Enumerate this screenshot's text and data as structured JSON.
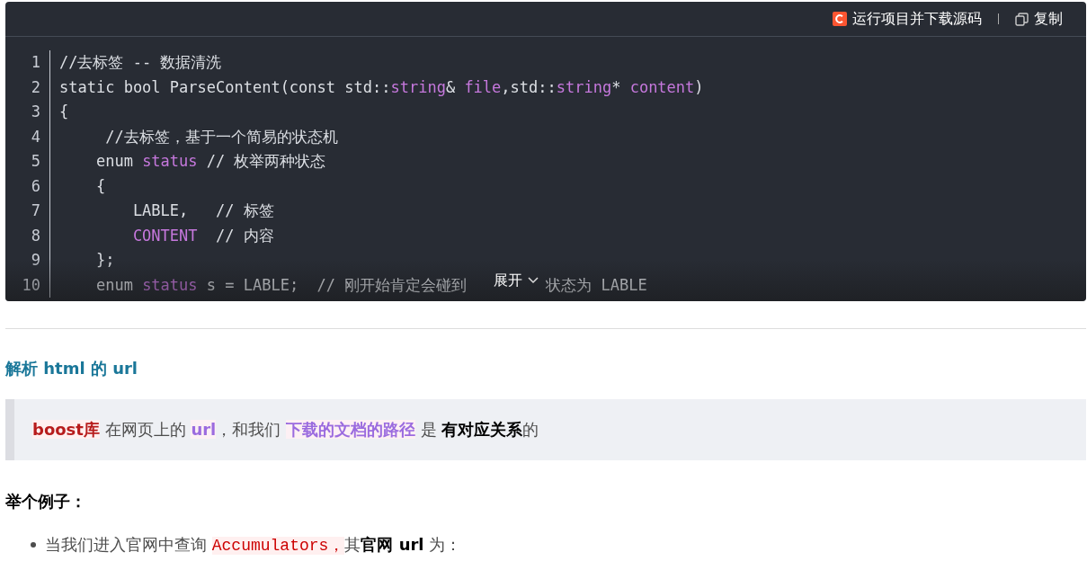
{
  "code_block": {
    "toolbar": {
      "run_label": "运行项目并下载源码",
      "copy_label": "复制"
    },
    "lines": [
      {
        "number": "1",
        "tokens": [
          {
            "kind": "plain",
            "text": "//去标签 -- 数据清洗"
          }
        ]
      },
      {
        "number": "2",
        "tokens": [
          {
            "kind": "plain",
            "text": "static bool ParseContent(const std::"
          },
          {
            "kind": "keyword",
            "text": "string"
          },
          {
            "kind": "plain",
            "text": "& "
          },
          {
            "kind": "keyword",
            "text": "file"
          },
          {
            "kind": "plain",
            "text": ",std::"
          },
          {
            "kind": "keyword",
            "text": "string"
          },
          {
            "kind": "plain",
            "text": "* "
          },
          {
            "kind": "keyword",
            "text": "content"
          },
          {
            "kind": "plain",
            "text": ")"
          }
        ]
      },
      {
        "number": "3",
        "tokens": [
          {
            "kind": "plain",
            "text": "{"
          }
        ]
      },
      {
        "number": "4",
        "tokens": [
          {
            "kind": "plain",
            "text": "     //去标签，基于一个简易的状态机"
          }
        ]
      },
      {
        "number": "5",
        "tokens": [
          {
            "kind": "plain",
            "text": "    enum "
          },
          {
            "kind": "keyword",
            "text": "status"
          },
          {
            "kind": "plain",
            "text": " // 枚举两种状态"
          }
        ]
      },
      {
        "number": "6",
        "tokens": [
          {
            "kind": "plain",
            "text": "    {"
          }
        ]
      },
      {
        "number": "7",
        "tokens": [
          {
            "kind": "plain",
            "text": "        LABLE,   // 标签"
          }
        ]
      },
      {
        "number": "8",
        "tokens": [
          {
            "kind": "keyword",
            "text": "        CONTENT"
          },
          {
            "kind": "plain",
            "text": "  // 内容"
          }
        ]
      },
      {
        "number": "9",
        "tokens": [
          {
            "kind": "plain",
            "text": "    };"
          }
        ]
      },
      {
        "number": "10",
        "tokens": [
          {
            "kind": "plain",
            "text": "    enum "
          },
          {
            "kind": "keyword",
            "text": "status"
          },
          {
            "kind": "plain",
            "text": " s = LABLE;  // 刚开始肯定会碰到"
          }
        ],
        "after_expand": "状态为 LABLE"
      }
    ],
    "expand_label": "展开"
  },
  "heading": "解析 html 的 url",
  "quote": [
    {
      "kind": "red",
      "text": "boost库"
    },
    {
      "kind": "plain",
      "text": " 在网页上的 "
    },
    {
      "kind": "purple",
      "text": "url"
    },
    {
      "kind": "plain",
      "text": "，和我们 "
    },
    {
      "kind": "purple",
      "text": "下载的文档的路径"
    },
    {
      "kind": "plain",
      "text": " 是 "
    },
    {
      "kind": "bold",
      "text": "有对应关系"
    },
    {
      "kind": "plain",
      "text": "的"
    }
  ],
  "example_title": "举个例子：",
  "bullets": [
    [
      {
        "kind": "plain",
        "text": "当我们进入官网中查询 "
      },
      {
        "kind": "code",
        "text": "Accumulators，"
      },
      {
        "kind": "plain",
        "text": "其"
      },
      {
        "kind": "bold",
        "text": "官网 url"
      },
      {
        "kind": "plain",
        "text": " 为："
      }
    ]
  ]
}
